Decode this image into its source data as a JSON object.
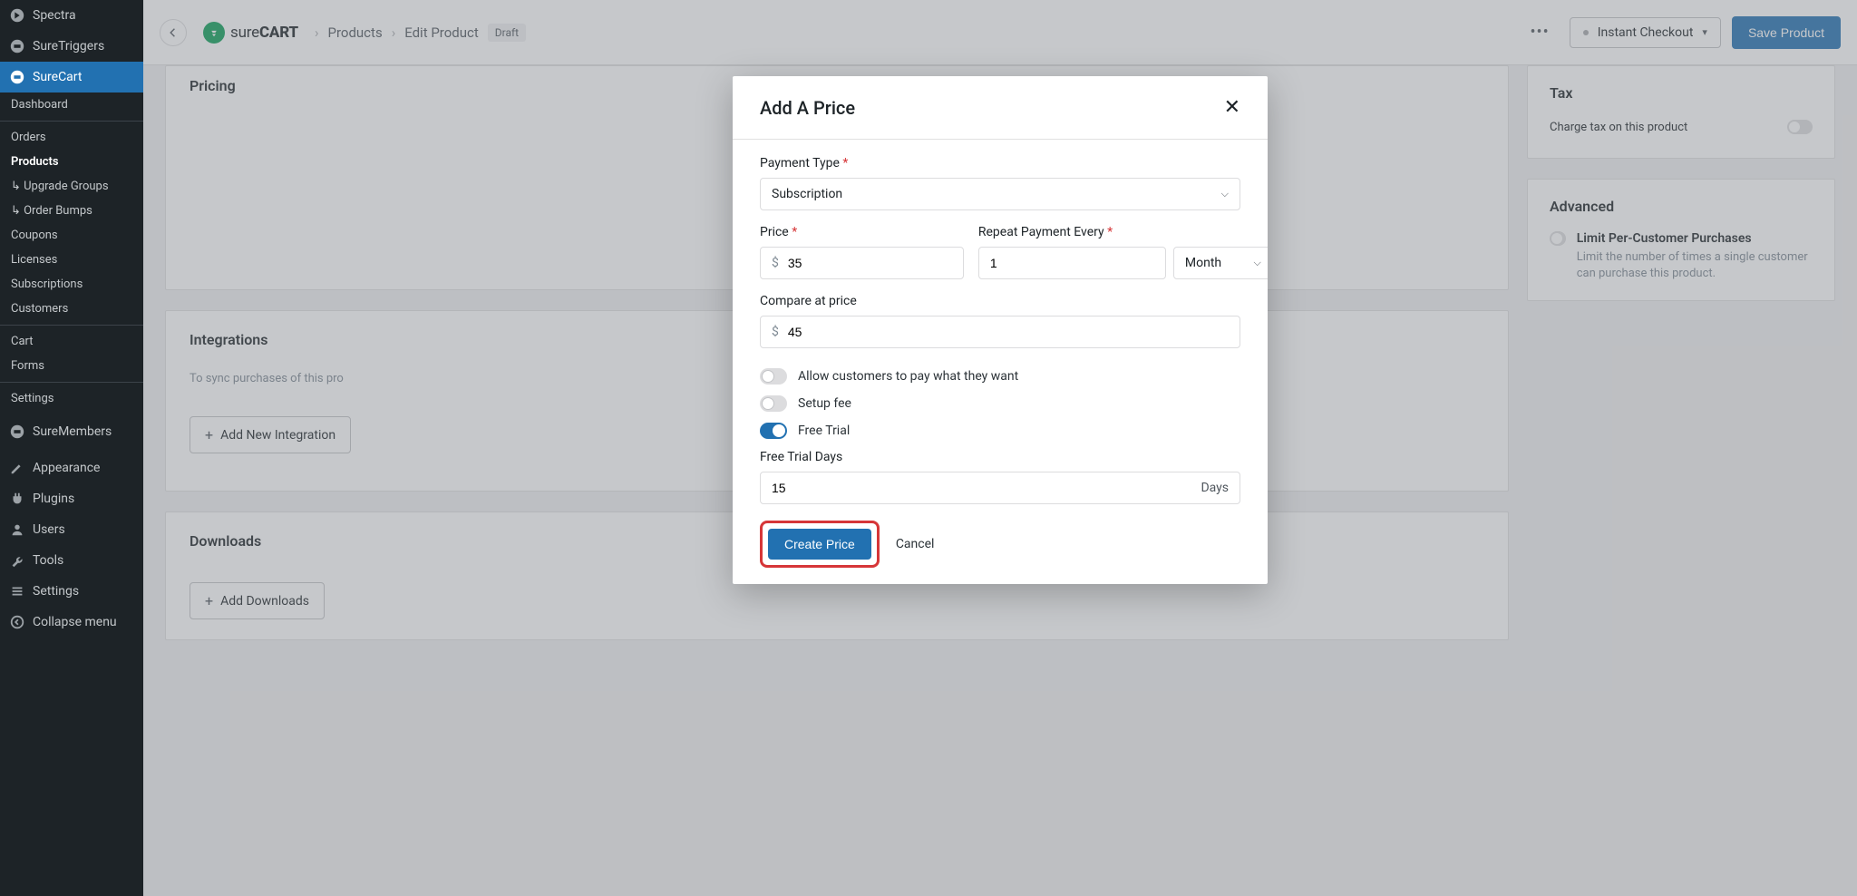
{
  "sidebar": {
    "top": [
      {
        "label": "Spectra",
        "icon": "spectra"
      },
      {
        "label": "SureTriggers",
        "icon": "sure"
      },
      {
        "label": "SureCart",
        "icon": "sure",
        "active": true
      }
    ],
    "sub": [
      {
        "label": "Dashboard"
      }
    ],
    "sc": [
      {
        "label": "Orders"
      },
      {
        "label": "Products",
        "bold": true
      },
      {
        "label": "↳ Upgrade Groups"
      },
      {
        "label": "↳ Order Bumps"
      },
      {
        "label": "Coupons"
      },
      {
        "label": "Licenses"
      },
      {
        "label": "Subscriptions"
      },
      {
        "label": "Customers"
      }
    ],
    "sc2": [
      {
        "label": "Cart"
      },
      {
        "label": "Forms"
      }
    ],
    "sc3": [
      {
        "label": "Settings"
      }
    ],
    "members": {
      "label": "SureMembers"
    },
    "bottom": [
      {
        "label": "Appearance",
        "icon": "brush"
      },
      {
        "label": "Plugins",
        "icon": "plug"
      },
      {
        "label": "Users",
        "icon": "user"
      },
      {
        "label": "Tools",
        "icon": "wrench"
      },
      {
        "label": "Settings",
        "icon": "settings"
      },
      {
        "label": "Collapse menu",
        "icon": "collapse"
      }
    ]
  },
  "topbar": {
    "brand1": "sure",
    "brand2": "CART",
    "crumbs": [
      "Products",
      "Edit Product"
    ],
    "status": "Draft",
    "instant": "Instant Checkout",
    "save": "Save Product"
  },
  "cards": {
    "pricing_title": "Pricing",
    "integrations_title": "Integrations",
    "integrations_desc": "To sync purchases of this pro",
    "add_integration": "Add New Integration",
    "downloads_title": "Downloads",
    "add_downloads": "Add Downloads",
    "tax_title": "Tax",
    "tax_row": "Charge tax on this product",
    "adv_title": "Advanced",
    "adv_row_title": "Limit Per-Customer Purchases",
    "adv_row_desc": "Limit the number of times a single customer can purchase this product."
  },
  "modal": {
    "title": "Add A Price",
    "payment_type_label": "Payment Type",
    "payment_type_value": "Subscription",
    "price_label": "Price",
    "price_currency": "$",
    "price_value": "35",
    "repeat_label": "Repeat Payment Every",
    "repeat_value": "1",
    "repeat_unit": "Month",
    "compare_label": "Compare at price",
    "compare_currency": "$",
    "compare_value": "45",
    "pwyw_label": "Allow customers to pay what they want",
    "setup_label": "Setup fee",
    "trial_label": "Free Trial",
    "trial_days_label": "Free Trial Days",
    "trial_days_value": "15",
    "trial_days_suffix": "Days",
    "create": "Create Price",
    "cancel": "Cancel"
  }
}
